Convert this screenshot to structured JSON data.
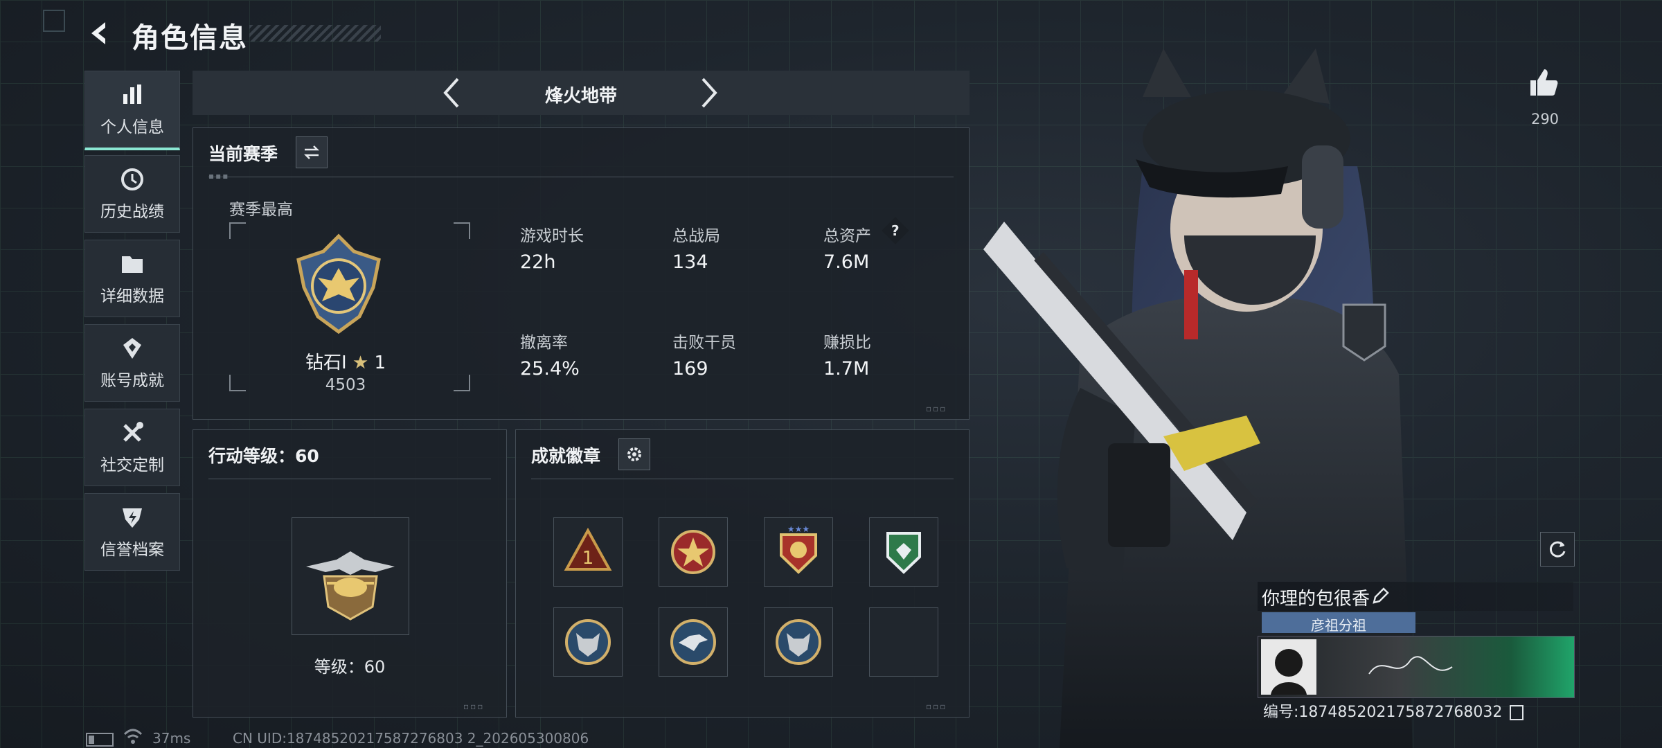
{
  "header": {
    "title": "角色信息"
  },
  "sidebar": {
    "items": [
      {
        "label": "个人信息",
        "icon": "bar-chart-icon",
        "active": true
      },
      {
        "label": "历史战绩",
        "icon": "history-clock-icon"
      },
      {
        "label": "详细数据",
        "icon": "folder-icon"
      },
      {
        "label": "账号成就",
        "icon": "achievement-icon"
      },
      {
        "label": "社交定制",
        "icon": "tools-icon"
      },
      {
        "label": "信誉档案",
        "icon": "shield-lightning-icon"
      }
    ]
  },
  "mode_nav": {
    "mode": "烽火地带"
  },
  "season": {
    "title": "当前赛季",
    "best_label": "赛季最高",
    "rank_name": "钻石I",
    "rank_star": "1",
    "rank_score": "4503",
    "stats": [
      {
        "label": "游戏时长",
        "value": "22h"
      },
      {
        "label": "总战局",
        "value": "134"
      },
      {
        "label": "总资产",
        "value": "7.6M",
        "help": "?"
      },
      {
        "label": "撤离率",
        "value": "25.4%"
      },
      {
        "label": "击败干员",
        "value": "169"
      },
      {
        "label": "赚损比",
        "value": "1.7M"
      }
    ]
  },
  "action_level": {
    "title": "行动等级：60",
    "level_text": "等级：60"
  },
  "badges": {
    "title": "成就徽章",
    "slots": [
      "rank-1-badge",
      "red-star-badge",
      "gold-shield-badge",
      "green-shield-badge",
      "wolf-badge",
      "eagle-badge",
      "wolf-badge-2",
      "empty"
    ]
  },
  "profile": {
    "likes": "290",
    "player_name": "你理的包很香",
    "group": "彦祖分祖",
    "player_id": "编号:1874852021758727680​32"
  },
  "status_bar": {
    "ping": "37ms",
    "uid": "CN UID:18748520217587276803 2_202605300806"
  },
  "colors": {
    "accent": "#8be7d3",
    "panel": "#1c2229",
    "banner_green": "#20a46a"
  }
}
